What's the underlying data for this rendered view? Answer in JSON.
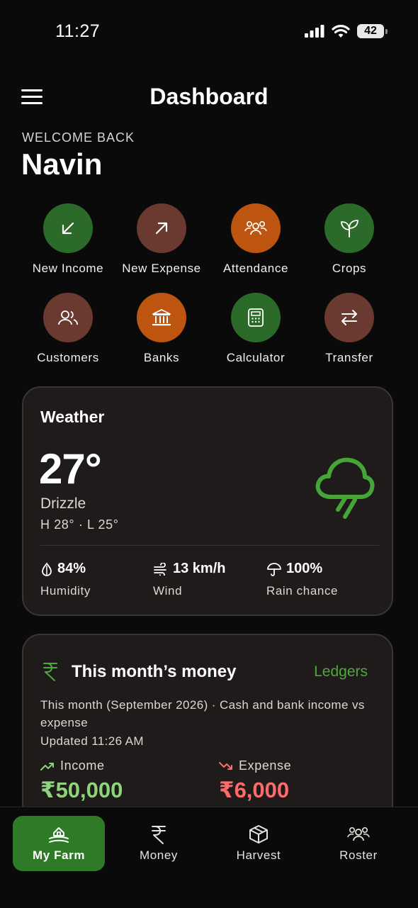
{
  "status_bar": {
    "time": "11:27",
    "battery": "42"
  },
  "header": {
    "title": "Dashboard"
  },
  "welcome": {
    "label": "WELCOME BACK",
    "name": "Navin"
  },
  "quick_actions": [
    {
      "label": "New Income",
      "icon": "arrow-down-left-icon",
      "color": "#2b6a28"
    },
    {
      "label": "New Expense",
      "icon": "arrow-up-right-icon",
      "color": "#6a3a30"
    },
    {
      "label": "Attendance",
      "icon": "people-group-icon",
      "color": "#bd5410"
    },
    {
      "label": "Crops",
      "icon": "leaf-icon",
      "color": "#2b6a28"
    },
    {
      "label": "Customers",
      "icon": "users-icon",
      "color": "#6a3a30"
    },
    {
      "label": "Banks",
      "icon": "bank-icon",
      "color": "#bd5410"
    },
    {
      "label": "Calculator",
      "icon": "calculator-icon",
      "color": "#2b6a28"
    },
    {
      "label": "Transfer",
      "icon": "transfer-arrows-icon",
      "color": "#6a3a30"
    }
  ],
  "weather": {
    "title": "Weather",
    "temp": "27°",
    "condition": "Drizzle",
    "high_low": "H 28° · L 25°",
    "icon": "cloud-drizzle-icon",
    "stats": [
      {
        "value": "84%",
        "label": "Humidity",
        "icon": "humidity-icon"
      },
      {
        "value": "13 km/h",
        "label": "Wind",
        "icon": "wind-icon"
      },
      {
        "value": "100%",
        "label": "Rain chance",
        "icon": "umbrella-icon"
      }
    ]
  },
  "money": {
    "title": "This month’s money",
    "link": "Ledgers",
    "subtitle": "This month (September 2026) · Cash and bank income vs expense",
    "updated": "Updated 11:26 AM",
    "income_label": "Income",
    "income_amount": "₹50,000",
    "expense_label": "Expense",
    "expense_amount": "₹6,000",
    "colors": {
      "income": "#8ed47a",
      "expense": "#ff6b6b",
      "accent": "#4caa3a"
    }
  },
  "bottom_nav": [
    {
      "label": "My Farm",
      "icon": "farm-icon",
      "active": true
    },
    {
      "label": "Money",
      "icon": "rupee-icon",
      "active": false
    },
    {
      "label": "Harvest",
      "icon": "box-icon",
      "active": false
    },
    {
      "label": "Roster",
      "icon": "people-group-icon",
      "active": false
    }
  ]
}
